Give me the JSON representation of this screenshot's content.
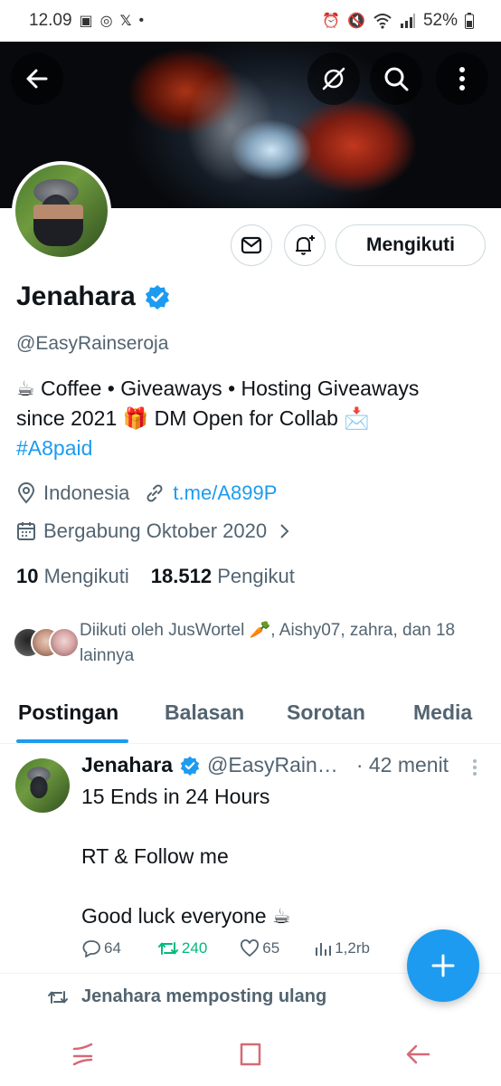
{
  "statusbar": {
    "time": "12.09",
    "battery": "52%"
  },
  "profile": {
    "name": "Jenahara",
    "handle": "@EasyRainseroja",
    "bio_lines": [
      "☕ Coffee • Giveaways • Hosting Giveaways",
      "since 2021 🎁 DM Open for Collab 📩"
    ],
    "bio_hashtag": "#A8paid",
    "location": "Indonesia",
    "website": "t.me/A899P",
    "joined": "Bergabung Oktober 2020",
    "following_count": "10",
    "following_label": "Mengikuti",
    "followers_count": "18.512",
    "followers_label": "Pengikut",
    "followed_by": "Diikuti oleh JusWortel 🥕, Aishy07, zahra, dan 18 lainnya",
    "follow_button": "Mengikuti"
  },
  "tabs": [
    {
      "label": "Postingan"
    },
    {
      "label": "Balasan"
    },
    {
      "label": "Sorotan"
    },
    {
      "label": "Media"
    }
  ],
  "post": {
    "name": "Jenahara",
    "handle": "@EasyRain…",
    "time": "· 42 menit",
    "text": "15 Ends in 24 Hours\n\nRT & Follow me\n\nGood luck everyone ☕",
    "replies": "64",
    "reposts": "240",
    "likes": "65",
    "views": "1,2rb"
  },
  "repost_notice": "Jenahara memposting ulang",
  "colors": {
    "accent": "#1d9bf0",
    "repost": "#00ba7c",
    "muted": "#536471"
  }
}
